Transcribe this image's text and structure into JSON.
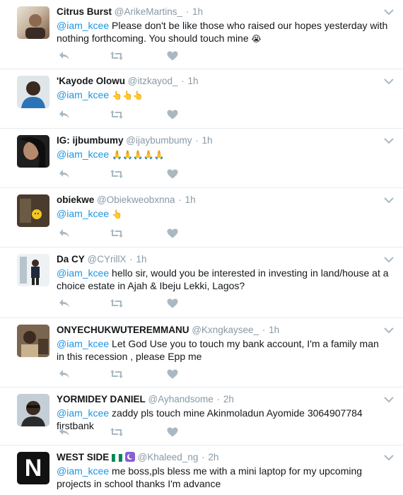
{
  "colors": {
    "name": "#14171a",
    "meta": "#8899a6",
    "mention": "#1b95e0",
    "icon": "#aab8c2",
    "divider": "#e6ecf0"
  },
  "icons": {
    "reply": "reply-arrow-icon",
    "retweet": "retweet-icon",
    "like": "heart-icon",
    "menu": "chevron-down-icon"
  },
  "tweets": [
    {
      "name": "Citrus Burst",
      "handle": "@ArikeMartins_",
      "time": "1h",
      "mention": "@iam_kcee",
      "text": " Please don't be like those who raised our hopes yesterday with nothing forthcoming. You should touch mine ",
      "emoji": "😭"
    },
    {
      "name": "'Kayode Olowu",
      "handle": "@itzkayod_",
      "time": "1h",
      "mention": "@iam_kcee",
      "text": " ",
      "emoji": "👆👆👆"
    },
    {
      "name": "IG: ijbumbumy",
      "handle": "@ijaybumbumy",
      "time": "1h",
      "mention": "@iam_kcee",
      "text": " ",
      "emoji": "🙏🙏🙏🙏🙏"
    },
    {
      "name": "obiekwe",
      "handle": "@Obiekweobxnna",
      "time": "1h",
      "mention": "@iam_kcee",
      "text": " ",
      "emoji": "👆"
    },
    {
      "name": "Da CY",
      "handle": "@CYrillX",
      "time": "1h",
      "mention": "@iam_kcee",
      "text": " hello sir, would you be interested in investing in land/house at a choice estate in Ajah & Ibeju Lekki, Lagos?",
      "emoji": ""
    },
    {
      "name": "ONYECHUKWUTEREMMANU",
      "handle": "@Kxngkaysee_",
      "time": "1h",
      "mention": "@iam_kcee",
      "text": " Let God Use you to touch my bank account, I'm a family man in this recession , please Epp me",
      "emoji": ""
    },
    {
      "name": "YORMIDEY DANIEL",
      "handle": "@Ayhandsome",
      "time": "2h",
      "mention": "@iam_kcee",
      "text": " zaddy pls touch mine Akinmoladun Ayomide 3064907784 firstbank",
      "emoji": ""
    },
    {
      "name": "WEST SIDE",
      "handle": "@Khaleed_ng",
      "time": "2h",
      "mention": "@iam_kcee",
      "text": " me boss,pls bless me with a mini laptop for my upcoming projects in school  thanks I'm advance",
      "emoji": "",
      "avatar_letter": "N"
    }
  ]
}
